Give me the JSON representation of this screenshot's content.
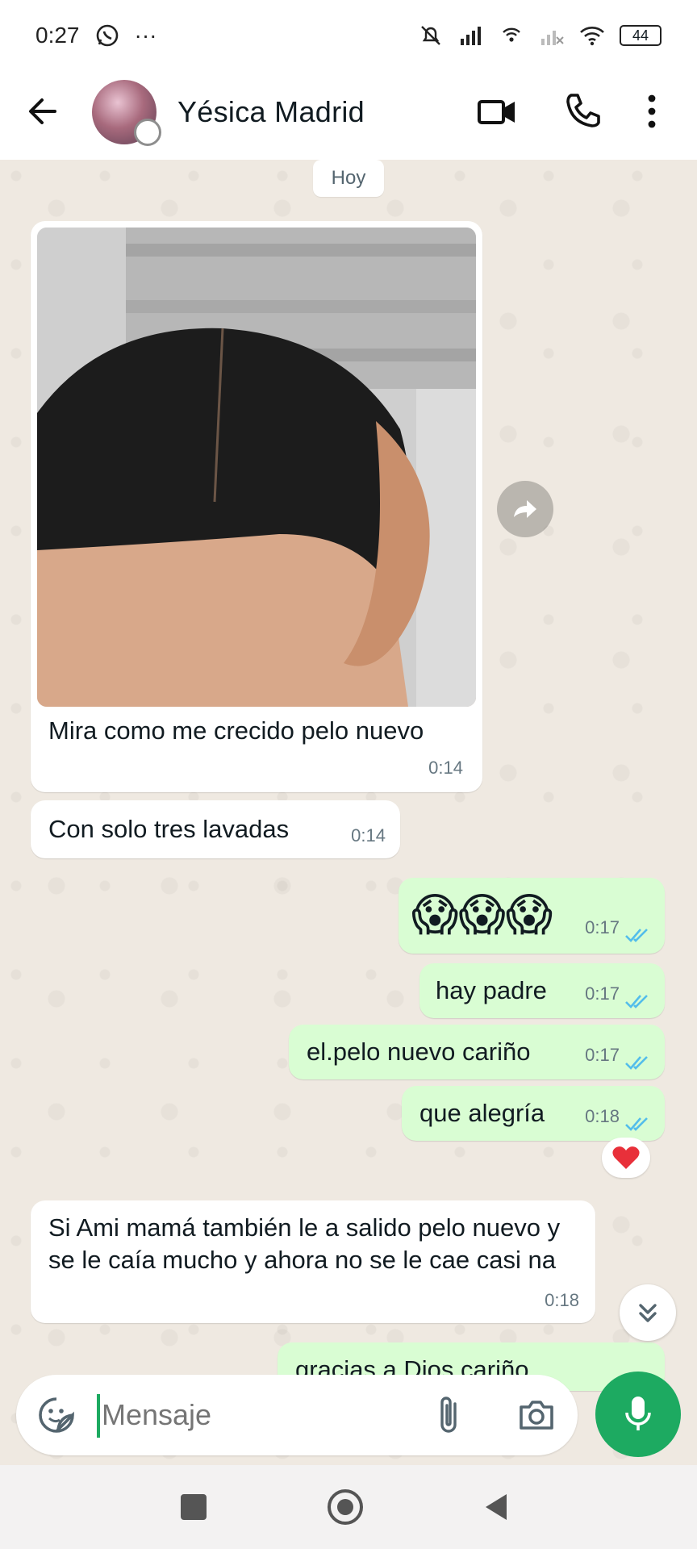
{
  "status_bar": {
    "time": "0:27",
    "more": "···",
    "battery": "44"
  },
  "header": {
    "contact_name": "Yésica Madrid"
  },
  "chat": {
    "date_chip": "Hoy",
    "messages": [
      {
        "direction": "in",
        "kind": "photo",
        "caption": "Mira como me crecido pelo nuevo",
        "time": "0:14"
      },
      {
        "direction": "in",
        "text": "Con solo tres lavadas",
        "time": "0:14"
      },
      {
        "direction": "out",
        "text": "😱😱😱",
        "time": "0:17",
        "status": "read"
      },
      {
        "direction": "out",
        "text": "hay padre",
        "time": "0:17",
        "status": "read"
      },
      {
        "direction": "out",
        "text": "el.pelo nuevo cariño",
        "time": "0:17",
        "status": "read"
      },
      {
        "direction": "out",
        "text": "que alegría",
        "time": "0:18",
        "status": "read",
        "reaction": "❤️"
      },
      {
        "direction": "in",
        "text": "Si Ami mamá también le a salido pelo nuevo y se le caía mucho y ahora no se le cae casi na",
        "time": "0:18"
      },
      {
        "direction": "out",
        "text": "gracias a Dios cariño",
        "partial": true
      }
    ]
  },
  "composer": {
    "placeholder": "Mensaje"
  },
  "colors": {
    "outgoing_bubble": "#d9fdd3",
    "incoming_bubble": "#ffffff",
    "chat_background": "#efe9e1",
    "accent_green": "#1daa61",
    "read_ticks": "#53bdeb"
  },
  "icons": [
    "back-arrow-icon",
    "video-call-icon",
    "phone-icon",
    "more-vert-icon",
    "forward-icon",
    "heart-icon",
    "chevron-double-down-icon",
    "sticker-icon",
    "attach-icon",
    "camera-icon",
    "mic-icon",
    "nav-recents-icon",
    "nav-home-icon",
    "nav-back-icon"
  ]
}
